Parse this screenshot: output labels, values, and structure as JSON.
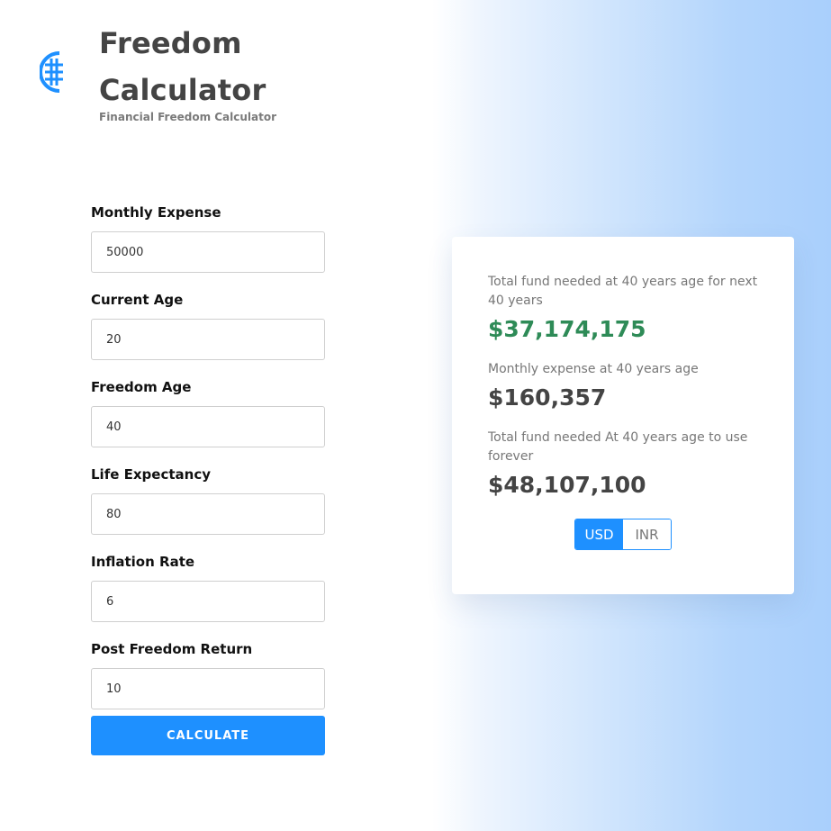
{
  "brand": {
    "title": "Freedom Calculator",
    "subtitle": "Financial Freedom Calculator",
    "logo_icon": "rupee-dollar-coin-icon"
  },
  "colors": {
    "accent": "#1e90ff",
    "positive": "#2e8b57",
    "gradient_end": "#a9cffc"
  },
  "form": {
    "fields": [
      {
        "label": "Monthly Expense",
        "value": "50000"
      },
      {
        "label": "Current Age",
        "value": "20"
      },
      {
        "label": "Freedom Age",
        "value": "40"
      },
      {
        "label": "Life Expectancy",
        "value": "80"
      },
      {
        "label": "Inflation Rate",
        "value": "6"
      },
      {
        "label": "Post Freedom Return",
        "value": "10"
      }
    ],
    "submit_label": "CALCULATE"
  },
  "results": {
    "total_fund_label": "Total fund needed at 40 years age for next 40 years",
    "total_fund_value": "$37,174,175",
    "monthly_expense_label": "Monthly expense at 40 years age",
    "monthly_expense_value": "$160,357",
    "forever_fund_label": "Total fund needed At 40 years age to use forever",
    "forever_fund_value": "$48,107,100"
  },
  "currency_toggle": {
    "options": [
      "USD",
      "INR"
    ],
    "selected": "USD"
  }
}
